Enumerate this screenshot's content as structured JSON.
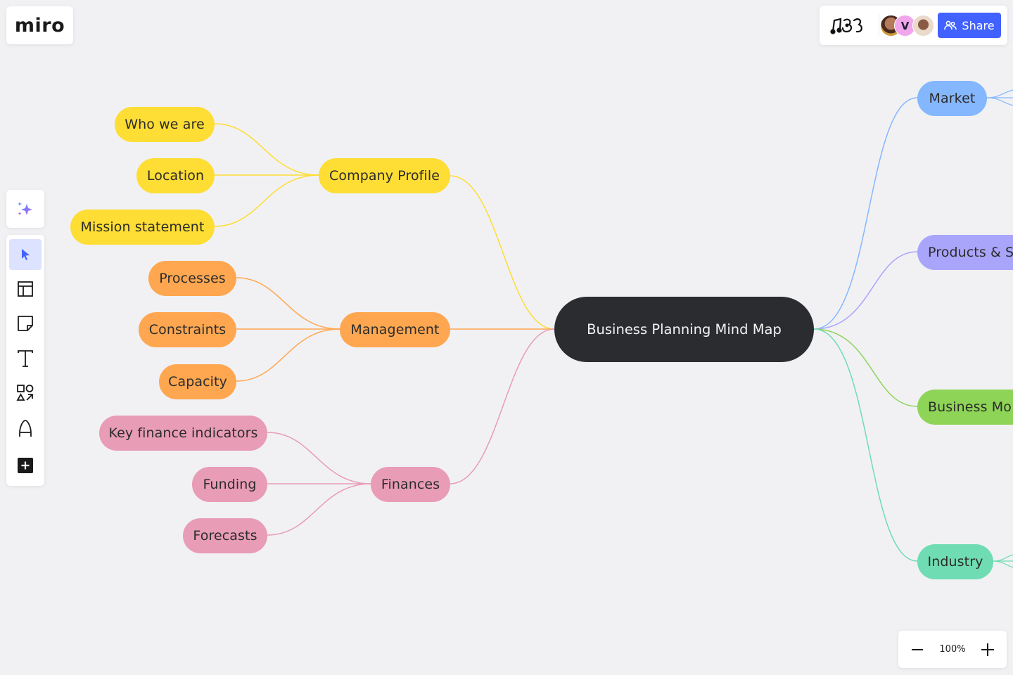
{
  "app": {
    "logo_text": "miro",
    "board_icon": "board-emoji-icon"
  },
  "header": {
    "collaborators": [
      {
        "name": "collaborator-1",
        "type": "photo"
      },
      {
        "name": "collaborator-2",
        "initial": "V"
      },
      {
        "name": "collaborator-3",
        "type": "photo"
      }
    ],
    "share_label": "Share"
  },
  "toolbar": {
    "ai_icon": "sparkles-icon",
    "tools": [
      {
        "name": "select-tool",
        "icon": "cursor-icon",
        "active": true
      },
      {
        "name": "templates-tool",
        "icon": "layout-icon"
      },
      {
        "name": "sticky-note-tool",
        "icon": "sticky-note-icon"
      },
      {
        "name": "text-tool",
        "icon": "text-icon"
      },
      {
        "name": "shapes-tool",
        "icon": "shapes-icon"
      },
      {
        "name": "pen-tool",
        "icon": "pen-icon"
      },
      {
        "name": "more-tools",
        "icon": "plus-icon"
      }
    ]
  },
  "zoom": {
    "level": "100%"
  },
  "mindmap": {
    "root": "Business Planning Mind Map",
    "colors": {
      "yellow": "#fedd34",
      "orange": "#ffa750",
      "pink": "#e89cb6",
      "blue": "#85b7ff",
      "purple": "#a9a5fb",
      "green": "#8ed457",
      "teal": "#6fdcb3",
      "root": "#2b2c30"
    },
    "left_branches": [
      {
        "label": "Company Profile",
        "color": "yellow",
        "children": [
          "Who we are",
          "Location",
          "Mission statement"
        ]
      },
      {
        "label": "Management",
        "color": "orange",
        "children": [
          "Processes",
          "Constraints",
          "Capacity"
        ]
      },
      {
        "label": "Finances",
        "color": "pink",
        "children": [
          "Key finance indicators",
          "Funding",
          "Forecasts"
        ]
      }
    ],
    "right_branches": [
      {
        "label": "Market",
        "color": "blue"
      },
      {
        "label": "Products & S",
        "color": "purple"
      },
      {
        "label": "Business Mo",
        "color": "green"
      },
      {
        "label": "Industry",
        "color": "teal"
      }
    ]
  }
}
